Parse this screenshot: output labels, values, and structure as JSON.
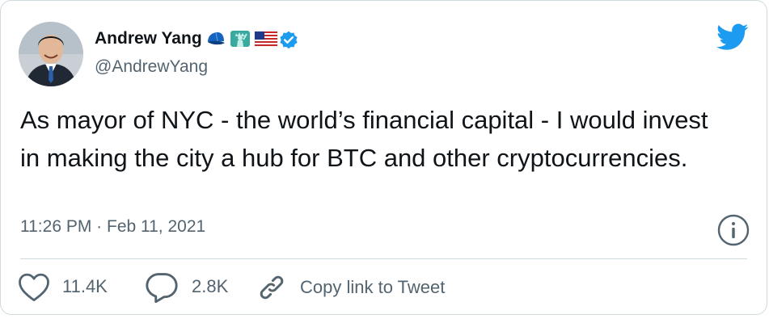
{
  "author": {
    "name": "Andrew Yang",
    "handle": "@AndrewYang",
    "emojis": [
      "blue-cap-icon",
      "statue-of-liberty-icon",
      "us-flag-icon"
    ],
    "verified": true
  },
  "tweet": {
    "text": "As mayor of NYC - the world’s financial capital - I would invest in making the city a hub for BTC and other cryptocurrencies.",
    "timestamp": "11:26 PM · Feb 11, 2021"
  },
  "actions": {
    "likes": "11.4K",
    "replies": "2.8K",
    "copy_link": "Copy link to Tweet"
  },
  "colors": {
    "twitter_blue": "#1d9bf0",
    "text_primary": "#0f1419",
    "text_secondary": "#536471",
    "border": "#cfd9de"
  }
}
